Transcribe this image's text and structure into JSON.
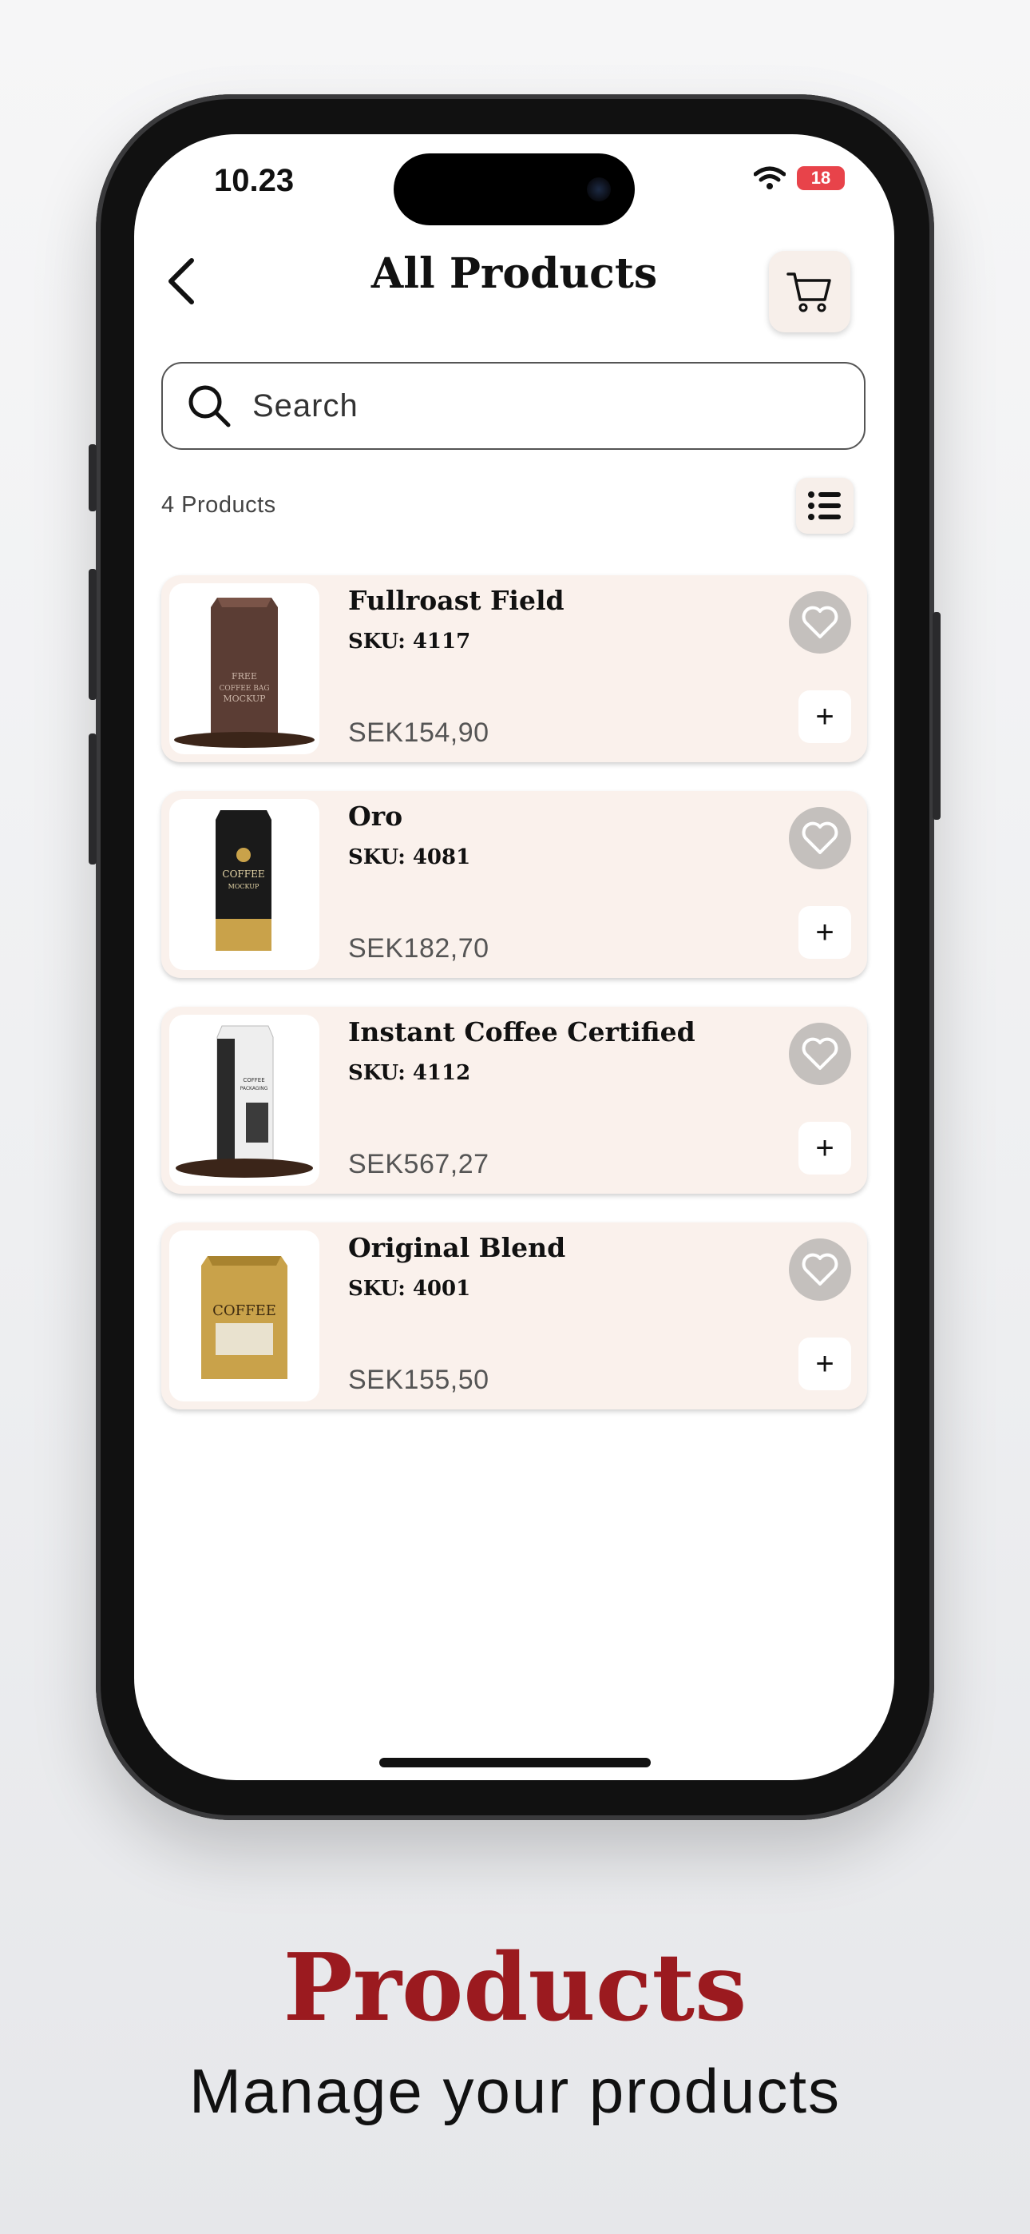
{
  "status_bar": {
    "time": "10.23",
    "battery": "18"
  },
  "header": {
    "title": "All Products"
  },
  "search": {
    "placeholder": "Search"
  },
  "list_header": {
    "count": "4 Products"
  },
  "products": [
    {
      "name": "Fullroast Field",
      "sku": "SKU: 4117",
      "price": "SEK154,90",
      "bag_color": "#5b3d34",
      "bag_label": "FREE COFFEE BAG MOCKUP"
    },
    {
      "name": "Oro",
      "sku": "SKU: 4081",
      "price": "SEK182,70",
      "bag_color": "#1a1a1a",
      "bag_label": "COFFEE MOCKUP"
    },
    {
      "name": "Instant Coffee Certified",
      "sku": "SKU: 4112",
      "price": "SEK567,27",
      "bag_color": "#f0f0f0",
      "bag_label": "COFFEE PACKAGING MOCKUP"
    },
    {
      "name": "Original Blend",
      "sku": "SKU: 4001",
      "price": "SEK155,50",
      "bag_color": "#c9a24a",
      "bag_label": "COFFEE"
    }
  ],
  "caption": {
    "title": "Products",
    "subtitle": "Manage your products"
  },
  "colors": {
    "accent": "#9b1a1f",
    "card_bg": "#faf1ec",
    "fav_bg": "#c4c0bd"
  }
}
